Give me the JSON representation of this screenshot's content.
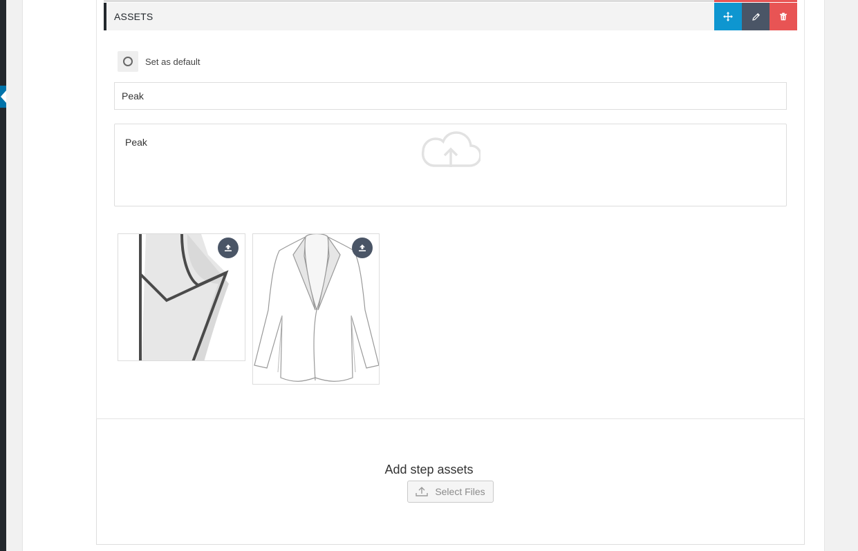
{
  "section": {
    "title": "ASSETS",
    "actions": [
      "move-icon",
      "pencil-icon",
      "trash-icon"
    ]
  },
  "default_toggle": {
    "label": "Set as default",
    "checked": false
  },
  "name_field": {
    "value": "Peak"
  },
  "description_field": {
    "value": "Peak"
  },
  "thumbnails": [
    {
      "name": "lapel-closeup",
      "icon": "upload-icon"
    },
    {
      "name": "jacket-front",
      "icon": "upload-icon"
    }
  ],
  "uploader": {
    "title": "Add step assets",
    "button_label": "Select Files"
  },
  "colors": {
    "move": "#0e96d0",
    "edit": "#4a5566",
    "delete": "#e85454",
    "rail": "#23282d",
    "rail_accent": "#0073aa"
  }
}
